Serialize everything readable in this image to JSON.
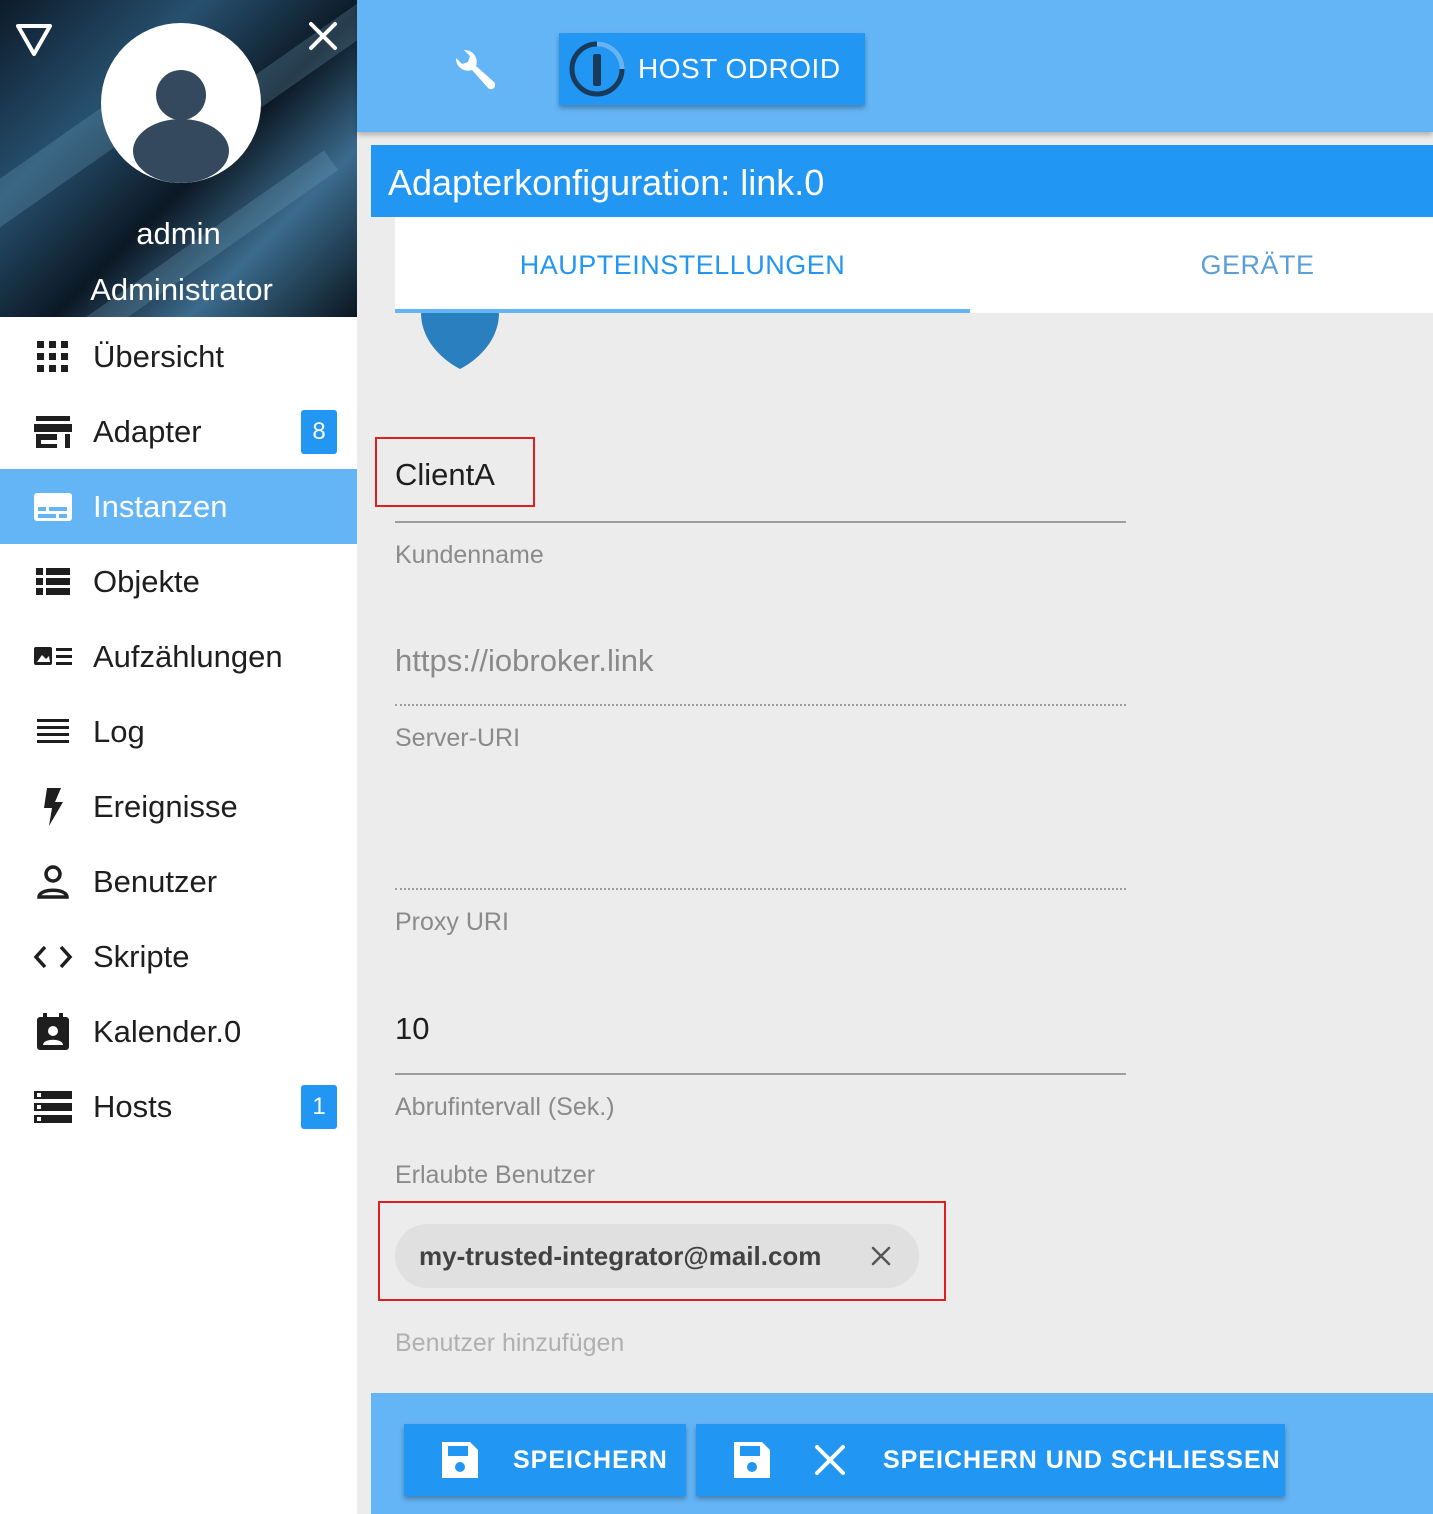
{
  "sidebar": {
    "user_name": "admin",
    "user_role": "Administrator",
    "items": [
      {
        "label": "Übersicht",
        "icon": "apps-grid-icon"
      },
      {
        "label": "Adapter",
        "icon": "store-icon",
        "badge": "8"
      },
      {
        "label": "Instanzen",
        "icon": "instances-icon",
        "active": true
      },
      {
        "label": "Objekte",
        "icon": "list-icon"
      },
      {
        "label": "Aufzählungen",
        "icon": "enum-icon"
      },
      {
        "label": "Log",
        "icon": "log-lines-icon"
      },
      {
        "label": "Ereignisse",
        "icon": "lightning-icon"
      },
      {
        "label": "Benutzer",
        "icon": "person-icon"
      },
      {
        "label": "Skripte",
        "icon": "code-icon"
      },
      {
        "label": "Kalender.0",
        "icon": "calendar-icon"
      },
      {
        "label": "Hosts",
        "icon": "hosts-icon",
        "badge": "1"
      }
    ]
  },
  "topbar": {
    "host_label": "HOST ODROID"
  },
  "title": "Adapterkonfiguration: link.0",
  "tabs": [
    {
      "label": "HAUPTEINSTELLUNGEN",
      "selected": true
    },
    {
      "label": "GERÄTE",
      "selected": false
    }
  ],
  "form": {
    "customer": {
      "value": "ClientA",
      "label": "Kundenname"
    },
    "server_uri": {
      "placeholder": "https://iobroker.link",
      "label": "Server-URI"
    },
    "proxy_uri": {
      "value": "",
      "label": "Proxy URI"
    },
    "interval": {
      "value": "10",
      "label": "Abrufintervall (Sek.)"
    },
    "allowed_users": {
      "label": "Erlaubte Benutzer",
      "chips": [
        "my-trusted-integrator@mail.com"
      ],
      "add_placeholder": "Benutzer hinzufügen"
    }
  },
  "footer": {
    "save_label": "SPEICHERN",
    "save_close_label": "SPEICHERN UND SCHLIESSEN"
  },
  "colors": {
    "primary": "#2196f3",
    "light_primary": "#64b5f6",
    "highlight_box": "#e02020"
  }
}
